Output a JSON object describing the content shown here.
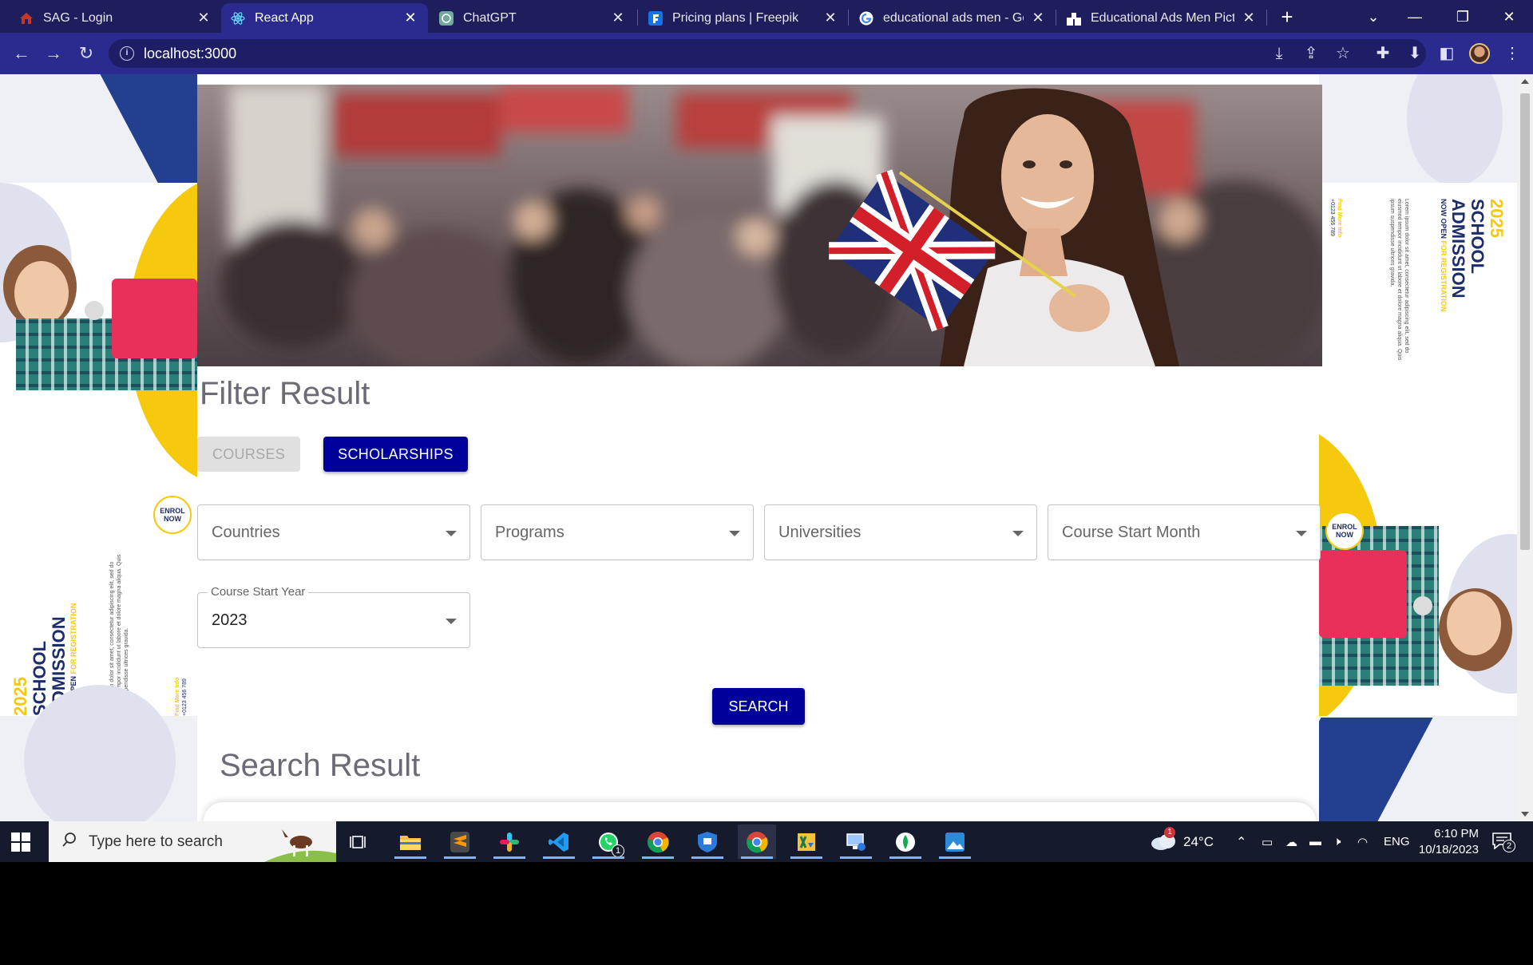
{
  "browser": {
    "tabs": [
      {
        "title": "SAG - Login",
        "icon": "house-logo-icon",
        "active": false
      },
      {
        "title": "React App",
        "icon": "react-icon",
        "active": true
      },
      {
        "title": "ChatGPT",
        "icon": "chatgpt-icon",
        "active": false
      },
      {
        "title": "Pricing plans | Freepik",
        "icon": "freepik-icon",
        "active": false
      },
      {
        "title": "educational ads men - Goo",
        "icon": "google-icon",
        "active": false
      },
      {
        "title": "Educational Ads Men Pictu",
        "icon": "site-logo-icon",
        "active": false
      }
    ],
    "url": "localhost:3000"
  },
  "page": {
    "filter_title": "Filter Result",
    "tab_courses": "COURSES",
    "tab_scholarships": "SCHOLARSHIPS",
    "selects": {
      "countries": "Countries",
      "programs": "Programs",
      "universities": "Universities",
      "course_start_month": "Course Start Month"
    },
    "year_select": {
      "label": "Course Start Year",
      "value": "2023"
    },
    "search_button": "SEARCH",
    "result_title": "Search Result"
  },
  "poster": {
    "year": "2025",
    "line1": "SCHOOL",
    "line2": "ADMISSION",
    "tagline_a": "NOW OPEN ",
    "tagline_b": "FOR REGISTRATION",
    "enrol": "ENROL NOW",
    "find_more": "Find More Info",
    "phone": "+0123 456 789",
    "lorem1": "Lorem ipsum dolor sit amet, consectetur adipiscing elit, sed do",
    "lorem2": "eiusmod tempor incididunt ut labore et dolore magna aliqua. Quis",
    "lorem3": "ipsum suspendisse ultrices gravida."
  },
  "taskbar": {
    "search_placeholder": "Type here to search",
    "weather": "24°C",
    "language": "ENG",
    "time": "6:10 PM",
    "date": "10/18/2023",
    "whatsapp_badge": "1",
    "notification_count": "2",
    "weather_badge": "1"
  },
  "colors": {
    "accent": "#00009a",
    "tab_strip": "#1e1e5c",
    "toolbar": "#2b2b8f",
    "poster_navy": "#1d2d6b",
    "poster_yellow": "#f6c90e"
  }
}
